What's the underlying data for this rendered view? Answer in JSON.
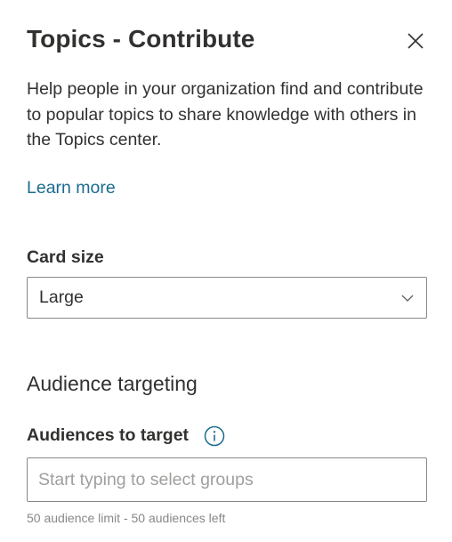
{
  "panel": {
    "title": "Topics - Contribute",
    "close_icon": "close-icon",
    "description": "Help people in your organization find and contribute to popular topics to share knowledge with others in the Topics center.",
    "learn_more": "Learn more"
  },
  "card_size": {
    "label": "Card size",
    "selected": "Large",
    "chevron_icon": "chevron-down-icon"
  },
  "audience": {
    "heading": "Audience targeting",
    "label": "Audiences to target",
    "info_icon": "info-icon",
    "placeholder": "Start typing to select groups",
    "value": "",
    "helper": "50 audience limit - 50 audiences left"
  },
  "colors": {
    "text": "#323130",
    "link": "#1a6b8f",
    "border": "#8a8886",
    "placeholder": "#a19f9d",
    "helper": "#8a8886"
  }
}
